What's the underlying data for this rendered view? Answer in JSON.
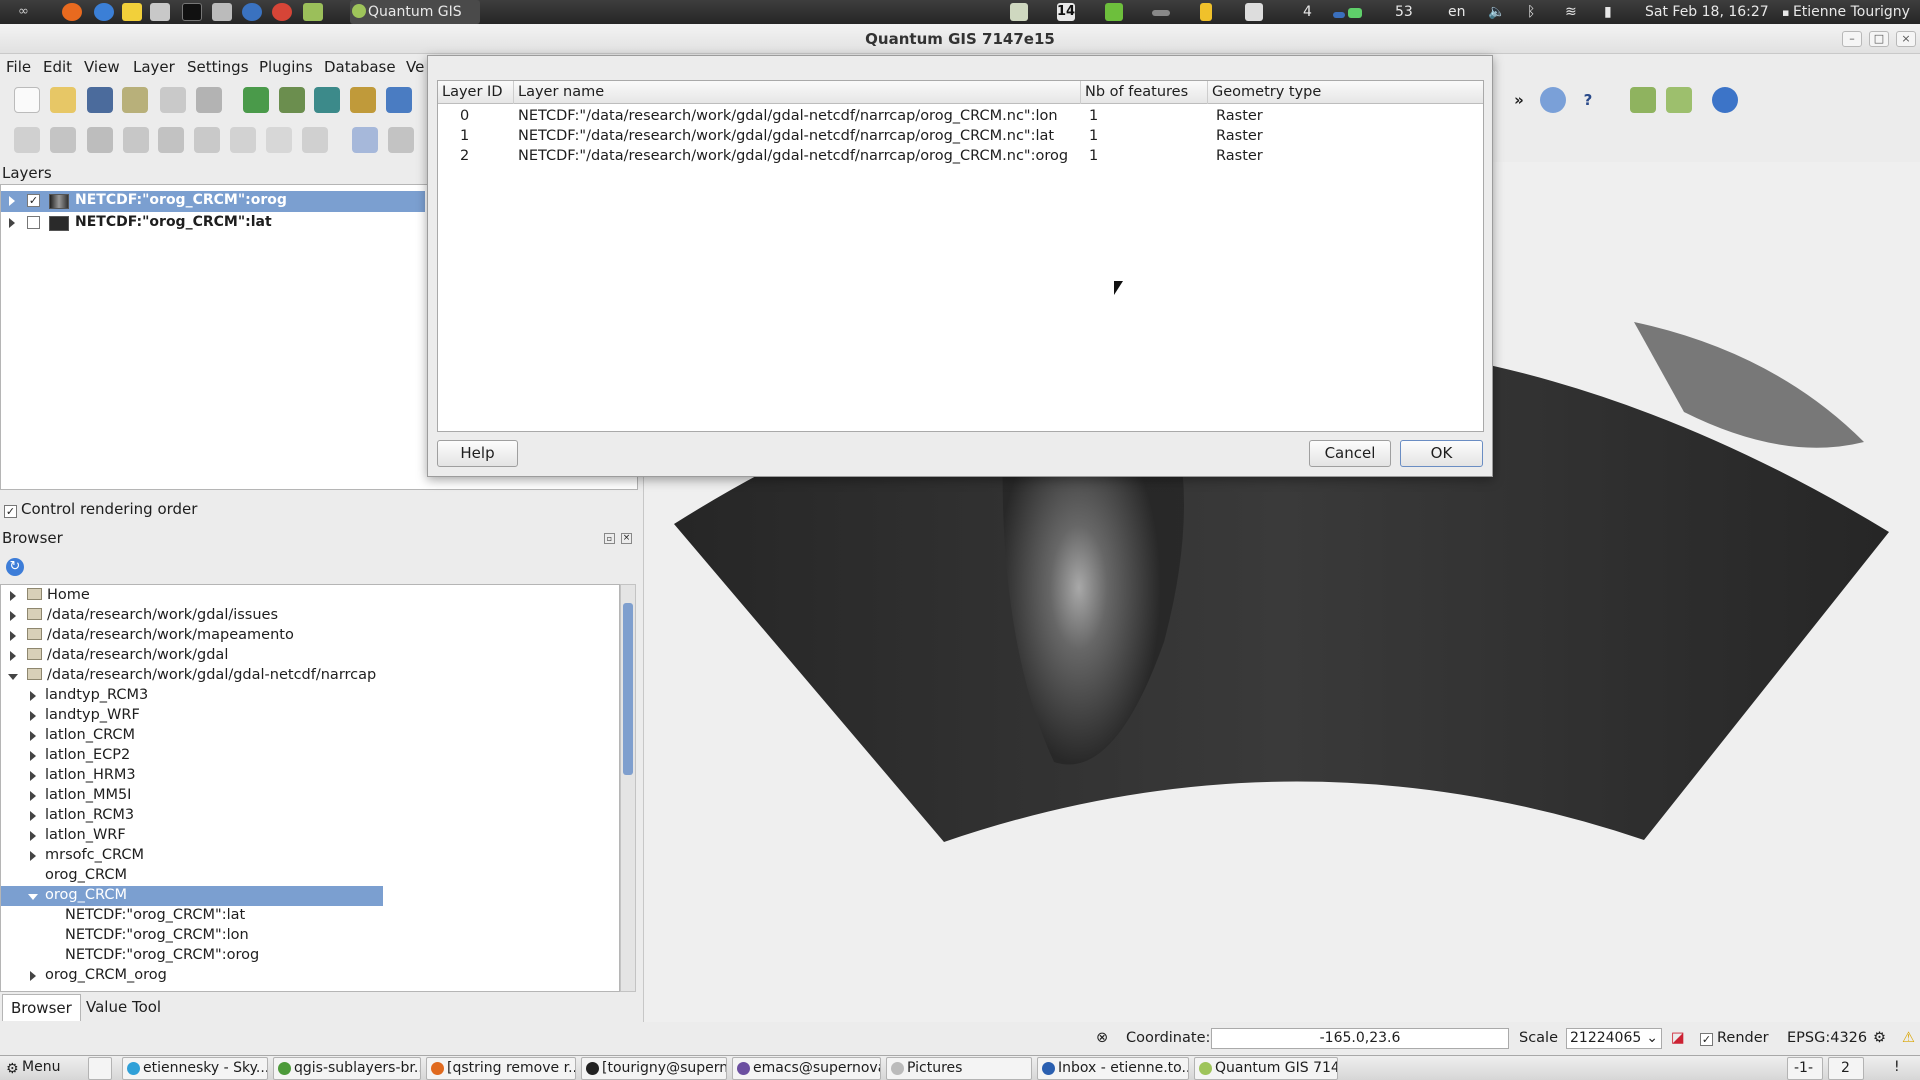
{
  "top_panel": {
    "app_label": "Quantum GIS",
    "workspace_num": "14",
    "tray_num_a": "4",
    "tray_num_b": "53",
    "lang": "en",
    "clock": "Sat Feb 18, 16:27",
    "user": "Etienne Tourigny"
  },
  "window": {
    "title": "Quantum GIS 7147e15"
  },
  "menu": [
    "File",
    "Edit",
    "View",
    "Layer",
    "Settings",
    "Plugins",
    "Database",
    "Ve"
  ],
  "layers_panel": {
    "title": "Layers",
    "items": [
      {
        "label": "NETCDF:\"orog_CRCM\":orog",
        "checked": true,
        "selected": true
      },
      {
        "label": "NETCDF:\"orog_CRCM\":lat",
        "checked": false,
        "selected": false
      }
    ],
    "render_order_label": "Control rendering order",
    "render_order_checked": true
  },
  "browser_panel": {
    "title": "Browser",
    "items": [
      {
        "label": "Home",
        "folder": true,
        "expand": "collapsed",
        "level": 0
      },
      {
        "label": "/data/research/work/gdal/issues",
        "folder": true,
        "expand": "collapsed",
        "level": 0
      },
      {
        "label": "/data/research/work/mapeamento",
        "folder": true,
        "expand": "collapsed",
        "level": 0
      },
      {
        "label": "/data/research/work/gdal",
        "folder": true,
        "expand": "collapsed",
        "level": 0
      },
      {
        "label": "/data/research/work/gdal/gdal-netcdf/narrcap",
        "folder": true,
        "expand": "expanded",
        "level": 0
      },
      {
        "label": "landtyp_RCM3",
        "folder": false,
        "expand": "collapsed",
        "level": 1
      },
      {
        "label": "landtyp_WRF",
        "folder": false,
        "expand": "collapsed",
        "level": 1
      },
      {
        "label": "latlon_CRCM",
        "folder": false,
        "expand": "collapsed",
        "level": 1
      },
      {
        "label": "latlon_ECP2",
        "folder": false,
        "expand": "collapsed",
        "level": 1
      },
      {
        "label": "latlon_HRM3",
        "folder": false,
        "expand": "collapsed",
        "level": 1
      },
      {
        "label": "latlon_MM5I",
        "folder": false,
        "expand": "collapsed",
        "level": 1
      },
      {
        "label": "latlon_RCM3",
        "folder": false,
        "expand": "collapsed",
        "level": 1
      },
      {
        "label": "latlon_WRF",
        "folder": false,
        "expand": "collapsed",
        "level": 1
      },
      {
        "label": "mrsofc_CRCM",
        "folder": false,
        "expand": "collapsed",
        "level": 1
      },
      {
        "label": "orog_CRCM",
        "folder": false,
        "expand": "none",
        "level": 1
      },
      {
        "label": "orog_CRCM",
        "folder": false,
        "expand": "expanded",
        "level": 1,
        "selected": true
      },
      {
        "label": "NETCDF:\"orog_CRCM\":lat",
        "folder": false,
        "expand": "none",
        "level": 2
      },
      {
        "label": "NETCDF:\"orog_CRCM\":lon",
        "folder": false,
        "expand": "none",
        "level": 2
      },
      {
        "label": "NETCDF:\"orog_CRCM\":orog",
        "folder": false,
        "expand": "none",
        "level": 2
      },
      {
        "label": "orog_CRCM_orog",
        "folder": false,
        "expand": "collapsed",
        "level": 1
      }
    ],
    "tabs": [
      "Browser",
      "Value Tool"
    ]
  },
  "dialog": {
    "columns": [
      "Layer ID",
      "Layer name",
      "Nb of features",
      "Geometry type"
    ],
    "rows": [
      [
        "0",
        "NETCDF:\"/data/research/work/gdal/gdal-netcdf/narrcap/orog_CRCM.nc\":lon",
        "1",
        "Raster"
      ],
      [
        "1",
        "NETCDF:\"/data/research/work/gdal/gdal-netcdf/narrcap/orog_CRCM.nc\":lat",
        "1",
        "Raster"
      ],
      [
        "2",
        "NETCDF:\"/data/research/work/gdal/gdal-netcdf/narrcap/orog_CRCM.nc\":orog",
        "1",
        "Raster"
      ]
    ],
    "help_label": "Help",
    "cancel_label": "Cancel",
    "ok_label": "OK"
  },
  "status_bar": {
    "coordinate_label": "Coordinate:",
    "coordinate_value": "-165.0,23.6",
    "scale_label": "Scale",
    "scale_value": "21224065",
    "render_label": "Render",
    "render_checked": true,
    "crs": "EPSG:4326"
  },
  "taskbar": {
    "menu_label": "Menu",
    "tasks": [
      "etiennesky - Sky...",
      "qgis-sublayers-br...",
      "[qstring remove r...",
      "[tourigny@supern...",
      "emacs@supernova",
      "Pictures",
      "Inbox - etienne.to...",
      "Quantum GIS 714..."
    ],
    "pager_a": "-1-",
    "pager_b": "2",
    "alert": "!"
  },
  "colors": {
    "selection": "#7b9fd0",
    "panel_bg": "#ececec",
    "map_dark": "#242424",
    "top_panel": "#2e2e2e"
  }
}
